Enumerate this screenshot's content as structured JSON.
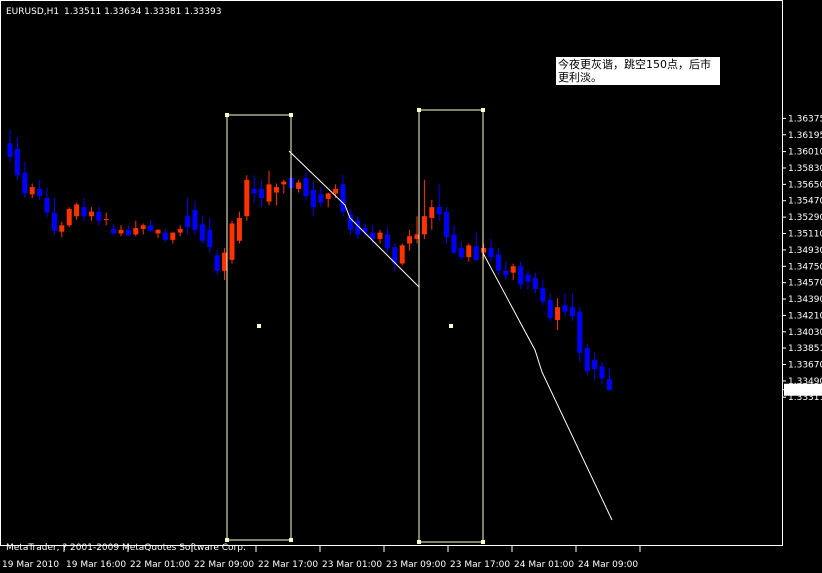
{
  "header": {
    "symbol": "EURUSD,H1",
    "ohlc": "1.33511 1.33634 1.33381 1.33393"
  },
  "footer": {
    "copyright": "MetaTrader, ? 2001-2009 MetaQuotes Software Corp."
  },
  "annotation": {
    "text": "今夜更灰谐，跳空150点，后市\n更利淡。"
  },
  "colors": {
    "background": "#000000",
    "bull": "#ff3300",
    "bear": "#0000ff",
    "lines": "#ffffff",
    "rectangles": "#ffffcc"
  },
  "chart_data": {
    "type": "candlestick",
    "title": "EURUSD,H1",
    "x_ticks": [
      "19 Mar 2010",
      "19 Mar 16:00",
      "22 Mar 01:00",
      "22 Mar 09:00",
      "22 Mar 17:00",
      "23 Mar 01:00",
      "23 Mar 09:00",
      "23 Mar 17:00",
      "24 Mar 01:00",
      "24 Mar 09:00"
    ],
    "y_ticks": [
      1.36375,
      1.36195,
      1.3601,
      1.3583,
      1.3565,
      1.3547,
      1.3529,
      1.3511,
      1.3493,
      1.3475,
      1.3457,
      1.3439,
      1.3421,
      1.3403,
      1.33851,
      1.3367,
      1.3349,
      1.33393,
      1.33311
    ],
    "current_price": 1.33393,
    "ylim": [
      1.3331,
      1.3639
    ],
    "candles_ohlc": [
      [
        1.361,
        1.3625,
        1.359,
        1.3595
      ],
      [
        1.3604,
        1.3617,
        1.357,
        1.3575
      ],
      [
        1.3578,
        1.359,
        1.355,
        1.3555
      ],
      [
        1.3554,
        1.3566,
        1.355,
        1.3562
      ],
      [
        1.356,
        1.357,
        1.3548,
        1.3552
      ],
      [
        1.355,
        1.3561,
        1.3529,
        1.3534
      ],
      [
        1.3534,
        1.355,
        1.351,
        1.3514
      ],
      [
        1.3513,
        1.3524,
        1.3507,
        1.352
      ],
      [
        1.352,
        1.354,
        1.3518,
        1.3538
      ],
      [
        1.353,
        1.3545,
        1.3526,
        1.3543
      ],
      [
        1.354,
        1.355,
        1.3525,
        1.353
      ],
      [
        1.353,
        1.354,
        1.3525,
        1.3535
      ],
      [
        1.3535,
        1.354,
        1.352,
        1.3525
      ],
      [
        1.3527,
        1.3534,
        1.352,
        1.3527
      ],
      [
        1.3516,
        1.3522,
        1.351,
        1.3511
      ],
      [
        1.3511,
        1.352,
        1.3508,
        1.3515
      ],
      [
        1.3515,
        1.352,
        1.3508,
        1.3509
      ],
      [
        1.351,
        1.3525,
        1.3508,
        1.3517
      ],
      [
        1.3516,
        1.3522,
        1.351,
        1.352
      ],
      [
        1.352,
        1.3526,
        1.3512,
        1.3514
      ],
      [
        1.3511,
        1.3516,
        1.3506,
        1.3515
      ],
      [
        1.3512,
        1.3516,
        1.3502,
        1.3504
      ],
      [
        1.3504,
        1.3512,
        1.35,
        1.3512
      ],
      [
        1.3512,
        1.352,
        1.3508,
        1.3516
      ],
      [
        1.353,
        1.355,
        1.351,
        1.3518
      ],
      [
        1.3537,
        1.3547,
        1.351,
        1.3515
      ],
      [
        1.3521,
        1.353,
        1.35,
        1.3503
      ],
      [
        1.3515,
        1.3528,
        1.349,
        1.3496
      ],
      [
        1.3487,
        1.3492,
        1.3465,
        1.347
      ],
      [
        1.347,
        1.3495,
        1.346,
        1.349
      ],
      [
        1.3482,
        1.3525,
        1.3478,
        1.3522
      ],
      [
        1.3503,
        1.3535,
        1.35,
        1.3528
      ],
      [
        1.353,
        1.3575,
        1.3525,
        1.357
      ],
      [
        1.356,
        1.3575,
        1.3545,
        1.3555
      ],
      [
        1.356,
        1.357,
        1.354,
        1.355
      ],
      [
        1.3546,
        1.358,
        1.3542,
        1.3565
      ],
      [
        1.3556,
        1.3566,
        1.3542,
        1.3562
      ],
      [
        1.3565,
        1.357,
        1.3555,
        1.3568
      ],
      [
        1.3572,
        1.358,
        1.3558,
        1.3561
      ],
      [
        1.356,
        1.357,
        1.3556,
        1.3567
      ],
      [
        1.3572,
        1.3578,
        1.3548,
        1.3552
      ],
      [
        1.3559,
        1.3569,
        1.353,
        1.354
      ],
      [
        1.3554,
        1.3562,
        1.354,
        1.3545
      ],
      [
        1.3549,
        1.3556,
        1.354,
        1.3555
      ],
      [
        1.3555,
        1.3565,
        1.355,
        1.356
      ],
      [
        1.3565,
        1.3575,
        1.353,
        1.3535
      ],
      [
        1.3532,
        1.3538,
        1.351,
        1.3515
      ],
      [
        1.3525,
        1.353,
        1.3505,
        1.351
      ],
      [
        1.3517,
        1.3522,
        1.3508,
        1.3512
      ],
      [
        1.3512,
        1.352,
        1.35,
        1.3505
      ],
      [
        1.3505,
        1.3515,
        1.35,
        1.3512
      ],
      [
        1.351,
        1.3518,
        1.349,
        1.3495
      ],
      [
        1.3496,
        1.35,
        1.347,
        1.3478
      ],
      [
        1.3478,
        1.35,
        1.3476,
        1.3498
      ],
      [
        1.35,
        1.3515,
        1.3492,
        1.3508
      ],
      [
        1.3505,
        1.353,
        1.35,
        1.351
      ],
      [
        1.351,
        1.357,
        1.3505,
        1.353
      ],
      [
        1.3528,
        1.3548,
        1.3515,
        1.354
      ],
      [
        1.354,
        1.3565,
        1.3525,
        1.3532
      ],
      [
        1.3535,
        1.354,
        1.35,
        1.3507
      ],
      [
        1.351,
        1.352,
        1.3488,
        1.349
      ],
      [
        1.3495,
        1.3502,
        1.3482,
        1.3485
      ],
      [
        1.3485,
        1.35,
        1.348,
        1.3498
      ],
      [
        1.3497,
        1.3512,
        1.348,
        1.3482
      ],
      [
        1.349,
        1.35,
        1.3482,
        1.3495
      ],
      [
        1.3495,
        1.3505,
        1.348,
        1.3485
      ],
      [
        1.3488,
        1.3495,
        1.3465,
        1.347
      ],
      [
        1.347,
        1.348,
        1.346,
        1.3465
      ],
      [
        1.3468,
        1.3478,
        1.346,
        1.3475
      ],
      [
        1.3475,
        1.348,
        1.345,
        1.3455
      ],
      [
        1.3466,
        1.347,
        1.345,
        1.3458
      ],
      [
        1.3462,
        1.3468,
        1.3445,
        1.345
      ],
      [
        1.3451,
        1.346,
        1.3432,
        1.3436
      ],
      [
        1.3438,
        1.3445,
        1.3415,
        1.3418
      ],
      [
        1.3416,
        1.344,
        1.3405,
        1.343
      ],
      [
        1.3432,
        1.3445,
        1.342,
        1.3425
      ],
      [
        1.343,
        1.3445,
        1.3415,
        1.342
      ],
      [
        1.3425,
        1.343,
        1.337,
        1.338
      ],
      [
        1.3385,
        1.339,
        1.3355,
        1.336
      ],
      [
        1.3372,
        1.338,
        1.335,
        1.3362
      ],
      [
        1.3365,
        1.337,
        1.3345,
        1.3352
      ],
      [
        1.3351,
        1.3363,
        1.3338,
        1.3339
      ]
    ]
  }
}
